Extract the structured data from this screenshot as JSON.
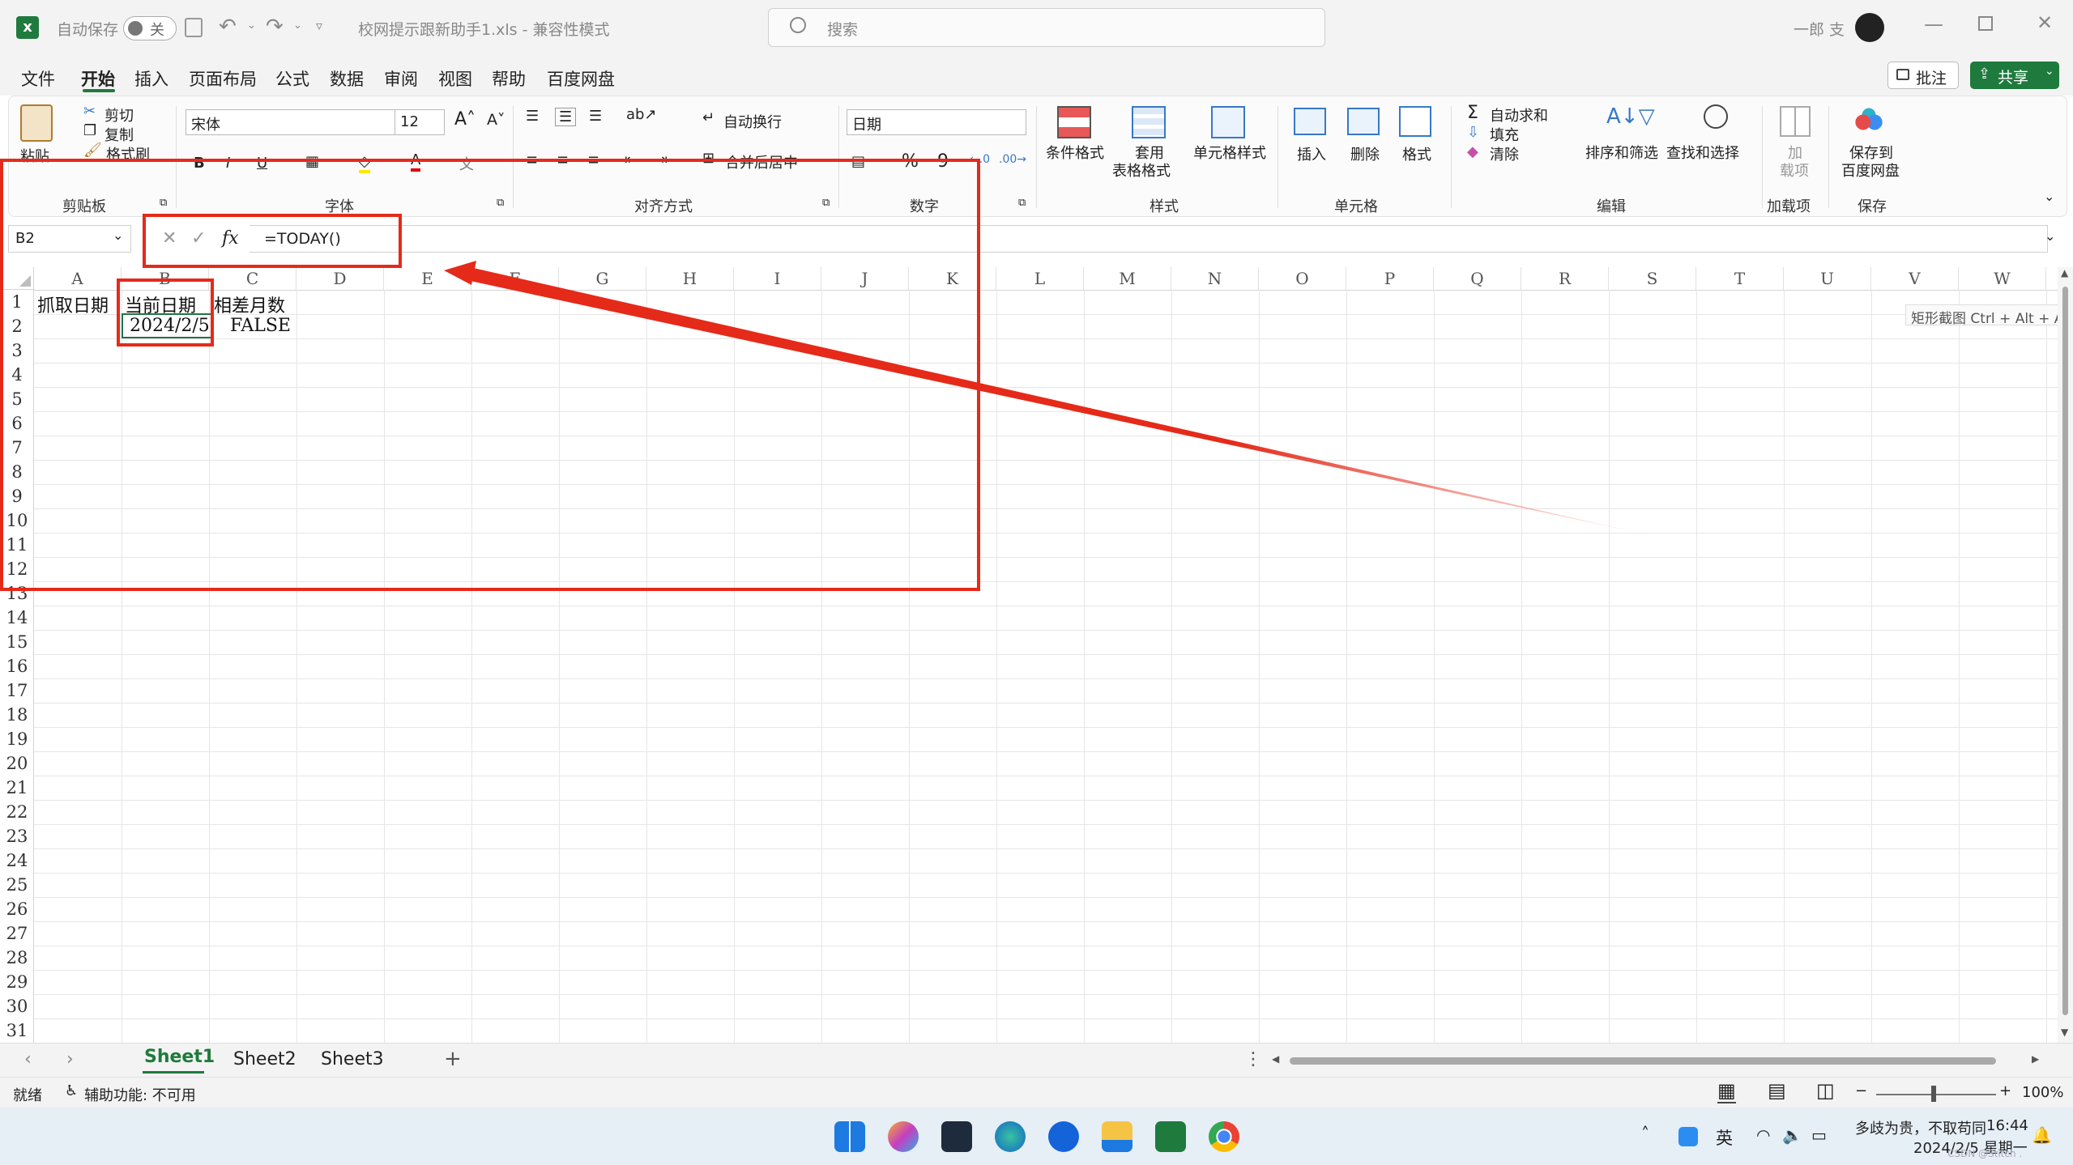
{
  "titlebar": {
    "autosave_label": "自动保存",
    "autosave_state": "关",
    "file_title": "校网提示跟新助手1.xls  -  兼容性模式",
    "search_placeholder": "搜索",
    "user_name": "一郎 支"
  },
  "menu": {
    "items": [
      "文件",
      "开始",
      "插入",
      "页面布局",
      "公式",
      "数据",
      "审阅",
      "视图",
      "帮助",
      "百度网盘"
    ],
    "active": "开始",
    "comment_button": "批注",
    "share_button": "共享"
  },
  "ribbon": {
    "clipboard": {
      "paste": "粘贴",
      "cut": "剪切",
      "copy": "复制",
      "format_painter": "格式刷",
      "group": "剪贴板"
    },
    "font": {
      "font_name": "宋体",
      "font_size": "12",
      "bold": "B",
      "italic": "I",
      "underline": "U",
      "group": "字体"
    },
    "alignment": {
      "wrap_text": "自动换行",
      "merge_center": "合并后居中",
      "group": "对齐方式"
    },
    "number": {
      "format": "日期",
      "percent": "%",
      "comma": "9",
      "group": "数字"
    },
    "styles": {
      "conditional": "条件格式",
      "table_line1": "套用",
      "table_line2": "表格格式",
      "cell_styles": "单元格样式",
      "group": "样式"
    },
    "cells": {
      "insert": "插入",
      "delete": "删除",
      "format": "格式",
      "group": "单元格"
    },
    "editing": {
      "autosum": "自动求和",
      "fill": "填充",
      "clear": "清除",
      "sort_filter": "排序和筛选",
      "find_select": "查找和选择",
      "group": "编辑"
    },
    "addins": {
      "line1": "加",
      "line2": "载项",
      "group": "加载项"
    },
    "save": {
      "line1": "保存到",
      "line2": "百度网盘",
      "group": "保存"
    }
  },
  "formula_bar": {
    "name_box": "B2",
    "fx": "fx",
    "formula": "=TODAY()"
  },
  "sheet": {
    "columns": [
      "A",
      "B",
      "C",
      "D",
      "E",
      "F",
      "G",
      "H",
      "I",
      "J",
      "K",
      "L",
      "M",
      "N",
      "O",
      "P",
      "Q",
      "R",
      "S",
      "T",
      "U",
      "V",
      "W"
    ],
    "rows": [
      "1",
      "2",
      "3",
      "4",
      "5",
      "6",
      "7",
      "8",
      "9",
      "10",
      "11",
      "12",
      "13",
      "14",
      "15",
      "16",
      "17",
      "18",
      "19",
      "20",
      "21",
      "22",
      "23",
      "24",
      "25",
      "26",
      "27",
      "28",
      "29",
      "30",
      "31"
    ],
    "cells": {
      "A1": "抓取日期",
      "B1": "当前日期",
      "C1": "相差月数",
      "B2": "2024/2/5",
      "C2": "FALSE"
    },
    "selected_cell": "B2"
  },
  "tooltip": "矩形截图 Ctrl + Alt + A",
  "sheet_tabs": [
    "Sheet1",
    "Sheet2",
    "Sheet3"
  ],
  "active_sheet": "Sheet1",
  "add_sheet": "+",
  "status": {
    "ready": "就绪",
    "accessibility": "辅助功能: 不可用",
    "zoom_minus": "−",
    "zoom_plus": "+",
    "zoom": "100%"
  },
  "taskbar": {
    "ime": "英",
    "notice": "多歧为贵，不取苟同",
    "time": "16:44",
    "date": "2024/2/5 星期一",
    "watermark": "CSDN @Stitch ."
  },
  "colors": {
    "excel_green": "#1f7a3d",
    "annotation_red": "#e52a1a",
    "selection_green": "#217346"
  }
}
